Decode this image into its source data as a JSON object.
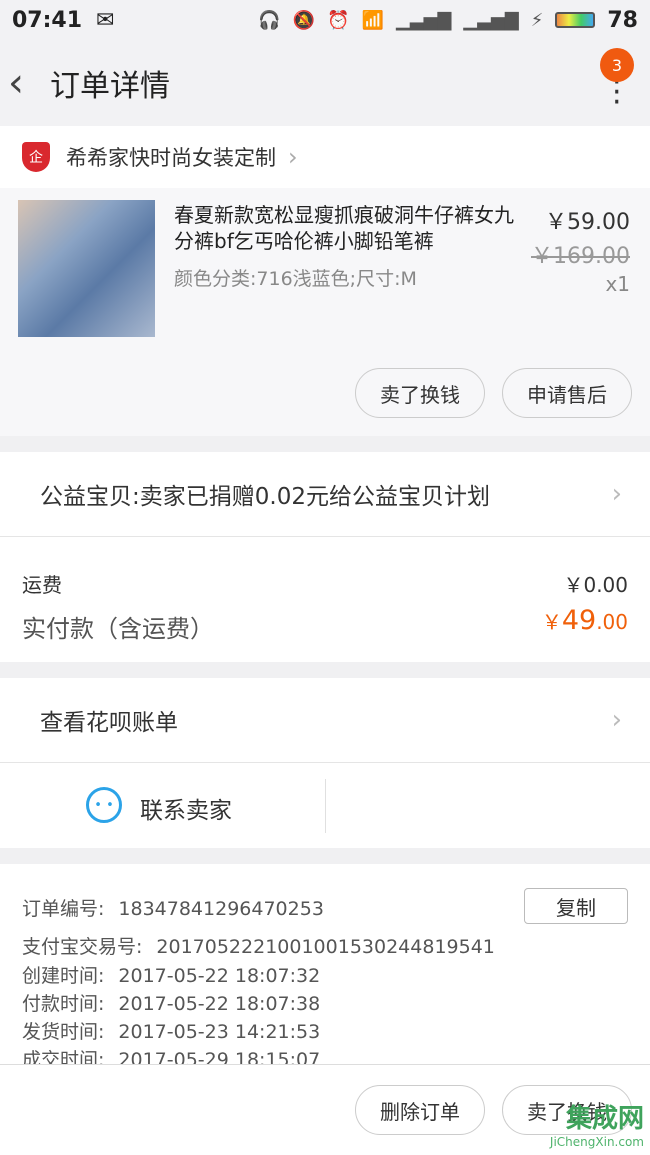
{
  "status": {
    "time": "07:41",
    "battery": "78"
  },
  "nav": {
    "back": "‹",
    "title": "订单详情",
    "badge": "3"
  },
  "shop": {
    "name": "希希家快时尚女装定制",
    "badge_icon": "企"
  },
  "product": {
    "title": "春夏新款宽松显瘦抓痕破洞牛仔裤女九分裤bf乞丐哈伦裤小脚铅笔裤",
    "spec": "颜色分类:716浅蓝色;尺寸:M",
    "price": "￥59.00",
    "original_price": "￥169.00",
    "qty": "x1",
    "btn_sell": "卖了换钱",
    "btn_aftersale": "申请售后"
  },
  "charity": {
    "text": "公益宝贝:卖家已捐赠0.02元给公益宝贝计划"
  },
  "fee": {
    "shipping_label": "运费",
    "shipping_value": "￥0.00",
    "paid_label": "实付款（含运费）",
    "paid_currency": "￥",
    "paid_int": "49",
    "paid_dec": ".00"
  },
  "huabei": {
    "text": "查看花呗账单"
  },
  "contact": {
    "label": "联系卖家"
  },
  "order_info": {
    "order_no_label": "订单编号:",
    "order_no": "18347841296470253",
    "copy": "复制",
    "alipay_label": "支付宝交易号:",
    "alipay_no": "2017052221001001530244819541",
    "created_label": "创建时间:",
    "created": "2017-05-22 18:07:32",
    "paid_label": "付款时间:",
    "paid": "2017-05-22 18:07:38",
    "shipped_label": "发货时间:",
    "shipped": "2017-05-23 14:21:53",
    "done_label": "成交时间:",
    "done": "2017-05-29 18:15:07"
  },
  "footer": {
    "delete": "删除订单",
    "sell": "卖了换钱"
  },
  "watermark": {
    "brand": "集成网",
    "url": "JiChengXin.com"
  }
}
